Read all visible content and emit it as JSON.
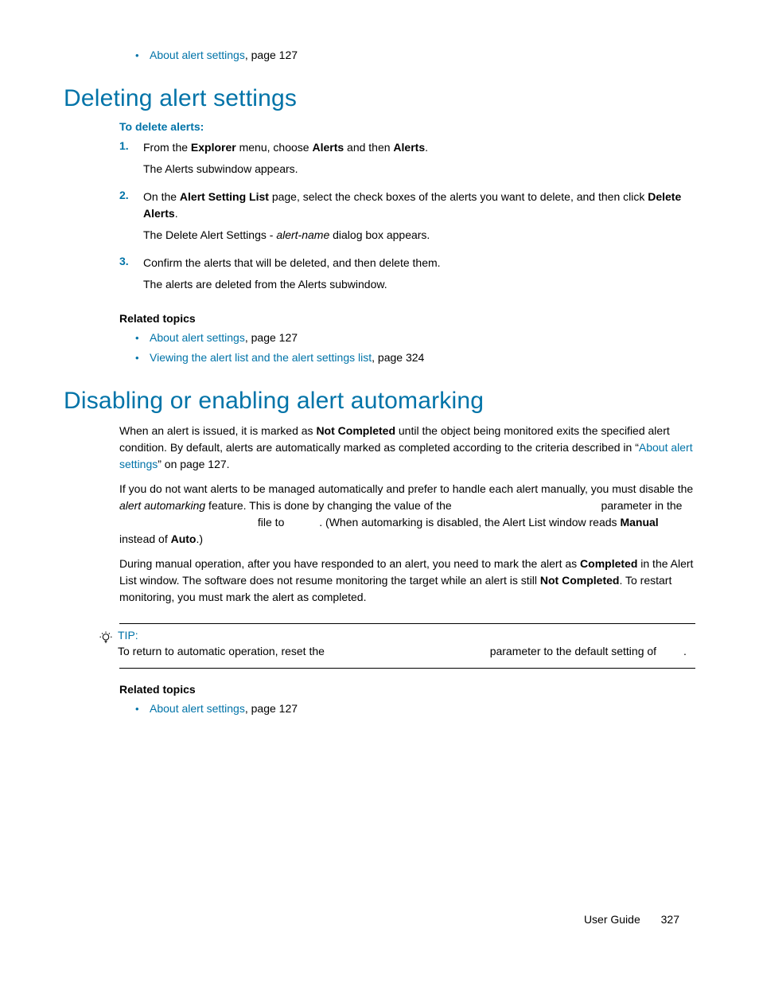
{
  "top_related": {
    "link": "About alert settings",
    "suffix": ", page 127"
  },
  "section1": {
    "title": "Deleting alert settings",
    "intro": "To delete alerts:",
    "steps": [
      {
        "num": "1.",
        "line1_a": "From the ",
        "line1_b": "Explorer",
        "line1_c": " menu, choose ",
        "line1_d": "Alerts",
        "line1_e": " and then ",
        "line1_f": "Alerts",
        "line1_g": ".",
        "line2": "The Alerts subwindow appears."
      },
      {
        "num": "2.",
        "line1_a": "On the ",
        "line1_b": "Alert Setting List",
        "line1_c": " page, select the check boxes of the alerts you want to delete, and then click ",
        "line1_d": "Delete Alerts",
        "line1_e": ".",
        "line2_a": "The Delete Alert Settings - ",
        "line2_b": "alert-name",
        "line2_c": " dialog box appears."
      },
      {
        "num": "3.",
        "line1": "Confirm the alerts that will be deleted, and then delete them.",
        "line2": "The alerts are deleted from the Alerts subwindow."
      }
    ],
    "related_label": "Related topics",
    "related": [
      {
        "link": "About alert settings",
        "suffix": ", page 127"
      },
      {
        "link": "Viewing the alert list and the alert settings list",
        "suffix": ", page 324"
      }
    ]
  },
  "section2": {
    "title": "Disabling or enabling alert automarking",
    "p1_a": "When an alert is issued, it is marked as ",
    "p1_b": "Not Completed",
    "p1_c": " until the object being monitored exits the specified alert condition. By default, alerts are automatically marked as completed according to the criteria described in “",
    "p1_link": "About alert settings",
    "p1_d": "” on page 127.",
    "p2_a": "If you do not want alerts to be managed automatically and prefer to handle each alert manually, you must disable the ",
    "p2_b": "alert automarking",
    "p2_c": " feature. This is done by changing the value of the ",
    "p2_blank1": "",
    "p2_d": " parameter in the ",
    "p2_blank2": "",
    "p2_e": " file to ",
    "p2_blank3": "",
    "p2_f": ". (When automarking is disabled, the Alert List window reads ",
    "p2_g": "Manual",
    "p2_h": " instead of ",
    "p2_i": "Auto",
    "p2_j": ".)",
    "p3_a": "During manual operation, after you have responded to an alert, you need to mark the alert as ",
    "p3_b": "Completed",
    "p3_c": " in the Alert List window. The software does not resume monitoring the target while an alert is still ",
    "p3_d": "Not Completed",
    "p3_e": ". To restart monitoring, you must mark the alert as completed.",
    "tip_label": "TIP:",
    "tip_a": "To return to automatic operation, reset the ",
    "tip_blank1": "",
    "tip_b": " parameter to the default setting of ",
    "tip_blank2": "",
    "tip_c": ".",
    "related_label": "Related topics",
    "related": [
      {
        "link": "About alert settings",
        "suffix": ", page 127"
      }
    ]
  },
  "footer": {
    "label": "User Guide",
    "page": "327"
  }
}
